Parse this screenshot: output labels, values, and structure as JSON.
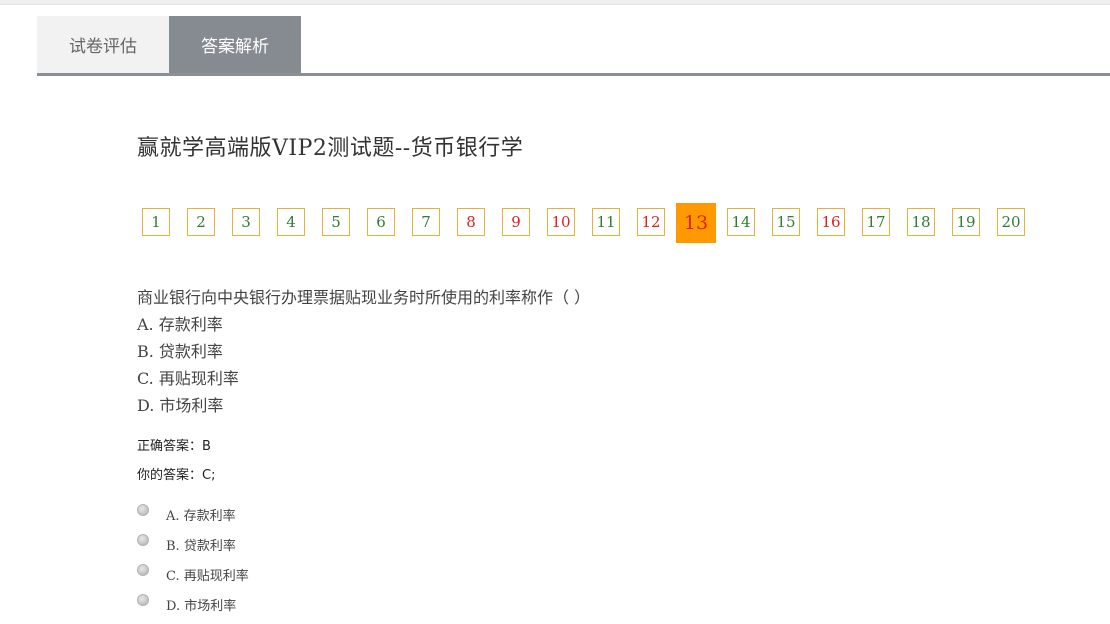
{
  "tabs": {
    "eval_label": "试卷评估",
    "answer_label": "答案解析"
  },
  "exam": {
    "title": "赢就学高端版VIP2测试题--货币银行学"
  },
  "question_nav": {
    "current": 13,
    "items": [
      {
        "label": "1",
        "status": "correct"
      },
      {
        "label": "2",
        "status": "correct"
      },
      {
        "label": "3",
        "status": "correct"
      },
      {
        "label": "4",
        "status": "correct"
      },
      {
        "label": "5",
        "status": "correct"
      },
      {
        "label": "6",
        "status": "correct"
      },
      {
        "label": "7",
        "status": "correct"
      },
      {
        "label": "8",
        "status": "wrong"
      },
      {
        "label": "9",
        "status": "wrong"
      },
      {
        "label": "10",
        "status": "wrong"
      },
      {
        "label": "11",
        "status": "correct"
      },
      {
        "label": "12",
        "status": "wrong"
      },
      {
        "label": "13",
        "status": "current"
      },
      {
        "label": "14",
        "status": "correct"
      },
      {
        "label": "15",
        "status": "correct"
      },
      {
        "label": "16",
        "status": "wrong"
      },
      {
        "label": "17",
        "status": "correct"
      },
      {
        "label": "18",
        "status": "correct"
      },
      {
        "label": "19",
        "status": "correct"
      },
      {
        "label": "20",
        "status": "correct"
      }
    ],
    "colors": {
      "correct": "#2f7d32",
      "wrong": "#e0201c",
      "current_bg": "#ff9900",
      "border": "#e4b33c"
    }
  },
  "question": {
    "stem": "商业银行向中央银行办理票据贴现业务时所使用的利率称作（ ）",
    "options": [
      "A. 存款利率",
      "B. 贷款利率",
      "C. 再贴现利率",
      "D. 市场利率"
    ]
  },
  "answers": {
    "correct_label": "正确答案：B",
    "yours_label": "你的答案：C;"
  },
  "choices": [
    "A. 存款利率",
    "B. 贷款利率",
    "C. 再贴现利率",
    "D. 市场利率"
  ]
}
